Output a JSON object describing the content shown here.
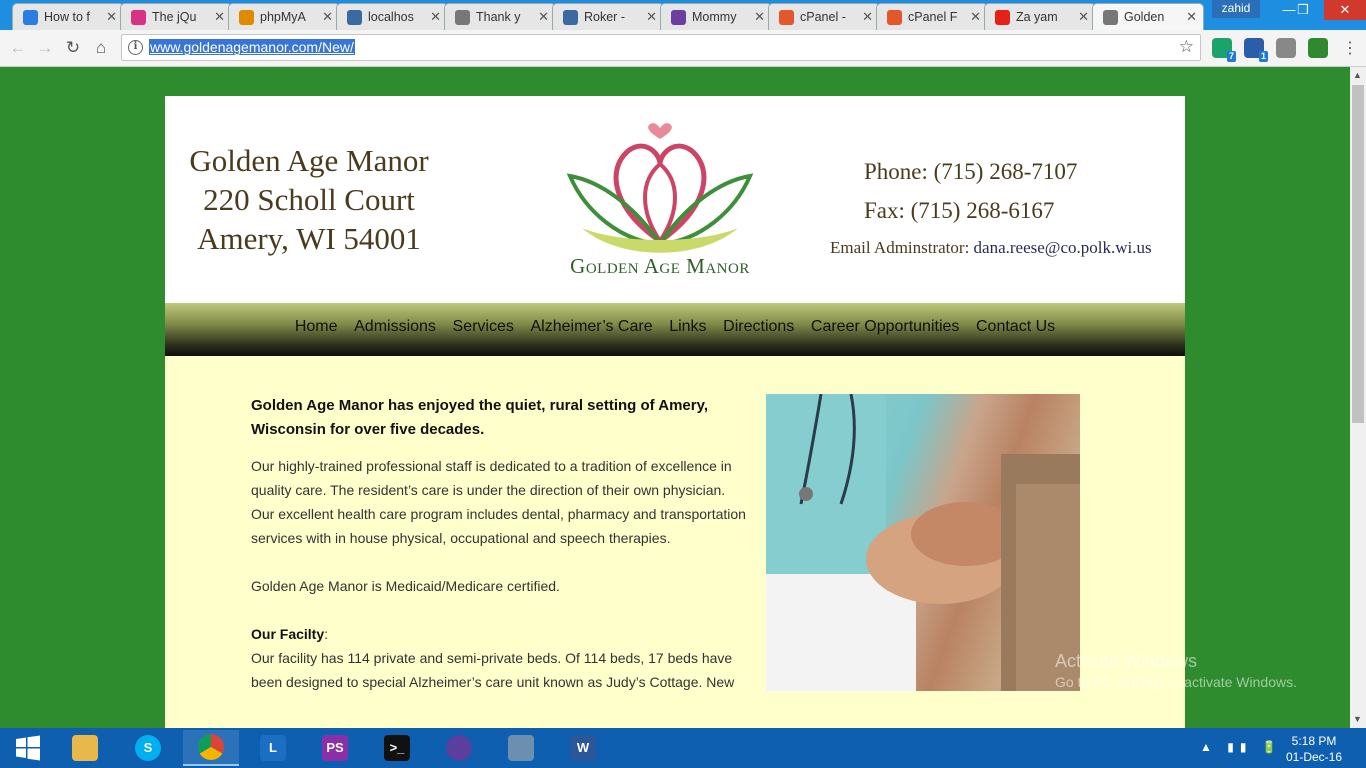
{
  "browser": {
    "tabs": [
      {
        "title": "How to f",
        "icon": "chevron-icon",
        "color": "#2a7de1"
      },
      {
        "title": "The jQu",
        "icon": "jquery-icon",
        "color": "#d63384"
      },
      {
        "title": "phpMyA",
        "icon": "pma-icon",
        "color": "#e08a00"
      },
      {
        "title": "localhos",
        "icon": "roker-icon",
        "color": "#3b6aa0"
      },
      {
        "title": "Thank y",
        "icon": "page-icon",
        "color": "#777777"
      },
      {
        "title": "Roker -",
        "icon": "roker-icon",
        "color": "#3b6aa0"
      },
      {
        "title": "Mommy",
        "icon": "mommy-icon",
        "color": "#6b3fa0"
      },
      {
        "title": "cPanel -",
        "icon": "cpanel-icon",
        "color": "#e2572b"
      },
      {
        "title": "cPanel F",
        "icon": "cpanel-icon",
        "color": "#e2572b"
      },
      {
        "title": "Za yam",
        "icon": "youtube-icon",
        "color": "#e62117"
      },
      {
        "title": "Golden",
        "icon": "page-icon",
        "color": "#777777",
        "active": true
      }
    ],
    "profile": "zahid",
    "url": "www.goldenagemanor.com/New/",
    "extensions": [
      {
        "icon": "grammar-icon",
        "badge": "7",
        "color": "#1aa36b"
      },
      {
        "icon": "translate-icon",
        "badge": "1",
        "color": "#2b5da8"
      },
      {
        "icon": "shield-icon",
        "badge": "",
        "color": "#888888"
      },
      {
        "icon": "download-icon",
        "badge": "",
        "color": "#2f8a2f"
      }
    ]
  },
  "site": {
    "address": [
      "Golden Age Manor",
      "220 Scholl Court",
      "Amery, WI 54001"
    ],
    "logo_text": "Golden Age Manor",
    "phone": "Phone: (715) 268-7107",
    "fax": "Fax: (715) 268-6167",
    "email_label": "Email Adminstrator:",
    "email": "dana.reese@co.polk.wi.us",
    "nav": [
      "Home",
      "Admissions",
      "Services",
      "Alzheimer’s Care",
      "Links",
      "Directions",
      "Career Opportunities",
      "Contact Us"
    ],
    "lead": "Golden Age Manor has enjoyed the quiet, rural setting of Amery, Wisconsin for over five decades.",
    "para1": "Our highly-trained professional staff is dedicated to a tradition of excellence in quality care. The resident’s care is under the direction of their own physician. Our excellent health care program includes dental, pharmacy and transportation services with in house physical, occupational and speech therapies.",
    "para2": "Golden Age Manor is Medicaid/Medicare certified.",
    "facility_heading": "Our Facilty",
    "facility_colon": ":",
    "facility_text": "Our facility has 114 private and semi-private beds. Of 114 beds, 17 beds have been designed to special Alzheimer’s care unit known as Judy’s Cottage. New"
  },
  "overlay": {
    "title": "Activate Windows",
    "subtitle": "Go to PC settings to activate Windows."
  },
  "taskbar": {
    "apps": [
      {
        "name": "file-explorer-icon",
        "label": "",
        "color": "#e8b84a"
      },
      {
        "name": "skype-icon",
        "label": "S",
        "color": "#00aff0"
      },
      {
        "name": "chrome-icon",
        "label": "",
        "color": "#db4437",
        "open": true
      },
      {
        "name": "lync-icon",
        "label": "L",
        "color": "#1b6fc2"
      },
      {
        "name": "phpstorm-icon",
        "label": "PS",
        "color": "#8b2fa8"
      },
      {
        "name": "terminal-icon",
        "label": ">_",
        "color": "#111111"
      },
      {
        "name": "cat-app-icon",
        "label": "",
        "color": "#5a3f9e"
      },
      {
        "name": "network-tool-icon",
        "label": "",
        "color": "#6c8fb0"
      },
      {
        "name": "word-icon",
        "label": "W",
        "color": "#2b579a"
      }
    ],
    "time": "5:18 PM",
    "date": "01-Dec-16"
  }
}
